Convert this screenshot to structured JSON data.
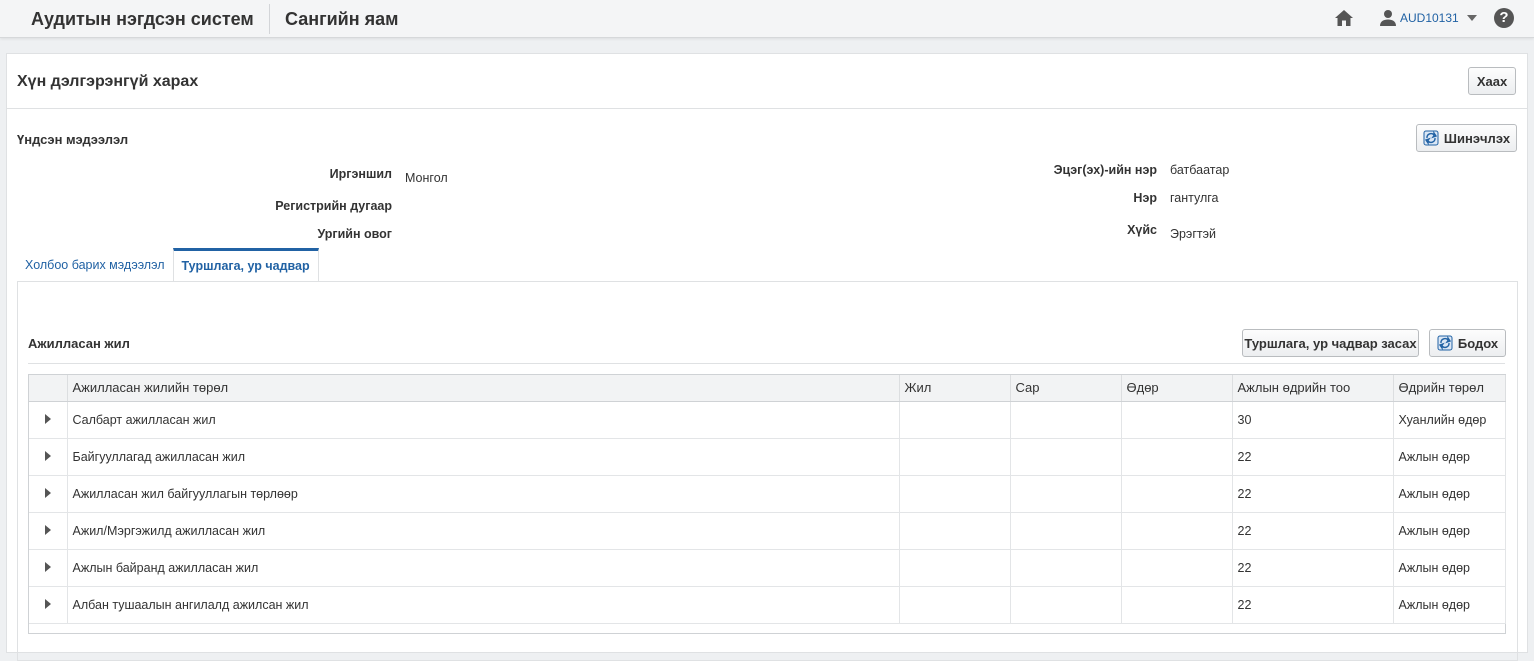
{
  "header": {
    "app_title": "Аудитын нэгдсэн систем",
    "org_title": "Сангийн яам",
    "user": "AUD10131"
  },
  "page": {
    "title": "Хүн дэлгэрэнгүй харах",
    "close_label": "Хаах"
  },
  "basic": {
    "title": "Үндсэн мэдээлэл",
    "refresh_label": "Шинэчлэх",
    "fields_left": [
      {
        "label": "Иргэншил",
        "value": "Монгол"
      },
      {
        "label": "Регистрийн дугаар",
        "value": ""
      },
      {
        "label": "Ургийн овог",
        "value": ""
      }
    ],
    "fields_right": [
      {
        "label": "Эцэг(эх)-ийн нэр",
        "value": "батбаатар"
      },
      {
        "label": "Нэр",
        "value": "гантулга"
      },
      {
        "label": "Хүйс",
        "value": "Эрэгтэй"
      }
    ]
  },
  "tabs": [
    {
      "label": "Холбоо барих мэдээлэл",
      "active": false
    },
    {
      "label": "Туршлага, ур чадвар",
      "active": true
    }
  ],
  "experience": {
    "title": "Ажилласан жил",
    "edit_label": "Туршлага, ур чадвар засах",
    "export_label": "Бодох",
    "columns": [
      "Ажилласан жилийн төрөл",
      "Жил",
      "Сар",
      "Өдөр",
      "Ажлын өдрийн тоо",
      "Өдрийн төрөл"
    ],
    "rows": [
      [
        "Салбарт ажилласан жил",
        "",
        "",
        "",
        "30",
        "Хуанлийн өдөр"
      ],
      [
        "Байгууллагад ажилласан жил",
        "",
        "",
        "",
        "22",
        "Ажлын өдөр"
      ],
      [
        "Ажилласан жил байгууллагын төрлөөр",
        "",
        "",
        "",
        "22",
        "Ажлын өдөр"
      ],
      [
        "Ажил/Мэргэжилд ажилласан жил",
        "",
        "",
        "",
        "22",
        "Ажлын өдөр"
      ],
      [
        "Ажлын байранд ажилласан жил",
        "",
        "",
        "",
        "22",
        "Ажлын өдөр"
      ],
      [
        "Албан тушаалын ангилалд ажилсан жил",
        "",
        "",
        "",
        "22",
        "Ажлын өдөр"
      ]
    ]
  },
  "colors": {
    "accent": "#2162a4",
    "border": "#dfe1e3"
  }
}
